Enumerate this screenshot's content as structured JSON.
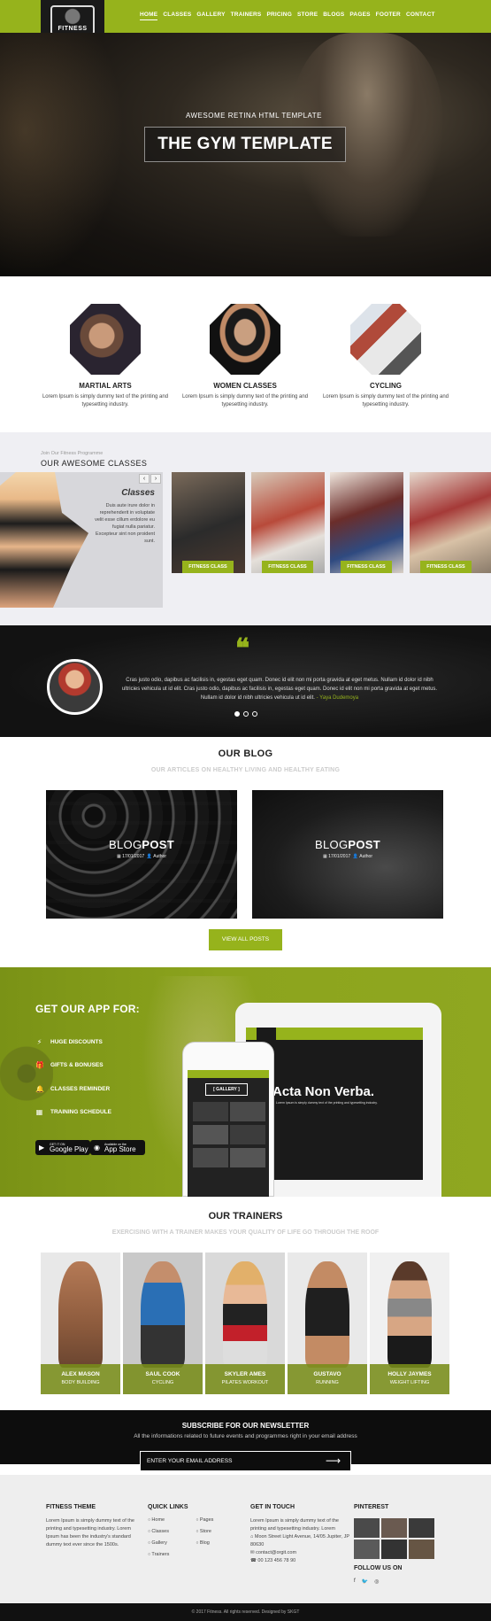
{
  "nav": {
    "logo_text": "FITNESS",
    "items": [
      "HOME",
      "CLASSES",
      "GALLERY",
      "TRAINERS",
      "PRICING",
      "STORE",
      "BLOGS",
      "PAGES",
      "FOOTER",
      "CONTACT"
    ]
  },
  "hero": {
    "subtitle": "AWESOME RETINA HTML TEMPLATE",
    "title": "THE GYM TEMPLATE"
  },
  "features": [
    {
      "title": "MARTIAL ARTS",
      "text": "Lorem Ipsum is simply dummy text of the printing and typesetting industry."
    },
    {
      "title": "WOMEN CLASSES",
      "text": "Lorem Ipsum is simply dummy text of the printing and typesetting industry."
    },
    {
      "title": "CYCLING",
      "text": "Lorem Ipsum is simply dummy text of the printing and typesetting industry."
    }
  ],
  "classes": {
    "pretitle": "Join Our Fitness Programme",
    "title": "OUR AWESOME CLASSES",
    "box_title": "Classes",
    "box_text": "Duis aute irure dolor in reprehenderit in voluptate velit esse cillum erdolore eu fugiat nulla pariatur. Excepteur sint non proident sunt.",
    "prev": "‹",
    "next": "›",
    "cards": [
      "FITNESS CLASS",
      "FITNESS CLASS",
      "FITNESS CLASS",
      "FITNESS CLASS"
    ]
  },
  "testimonial": {
    "quote_mark": "❝",
    "text": "Cras justo odio, dapibus ac facilisis in, egestas eget quam. Donec id elit non mi porta gravida at eget metus. Nullam id dolor id nibh ultricies vehicula ut id elit. Cras justo odio, dapibus ac facilisis in, egestas eget quam. Donec id elit non mi porta gravida at eget metus. Nullam id dolor id nibh ultricies vehicula ut id elit.",
    "author": "- Yaya Dudemoya"
  },
  "blog": {
    "title": "OUR BLOG",
    "subtitle": "OUR ARTICLES ON HEALTHY LIVING AND HEALTHY EATING",
    "posts": [
      {
        "light": "BLOG",
        "bold": "POST",
        "date": "17/01/2017",
        "author": "Author"
      },
      {
        "light": "BLOG",
        "bold": "POST",
        "date": "17/01/2017",
        "author": "Author"
      }
    ],
    "button": "VIEW ALL POSTS"
  },
  "app": {
    "title": "GET OUR APP FOR:",
    "features": [
      {
        "icon": "bolt-icon",
        "glyph": "⚡",
        "label": "HUGE DISCOUNTS"
      },
      {
        "icon": "gift-icon",
        "glyph": "🎁",
        "label": "GIFTS & BONUSES"
      },
      {
        "icon": "bell-icon",
        "glyph": "🔔",
        "label": "CLASSES REMINDER"
      },
      {
        "icon": "calendar-icon",
        "glyph": "▦",
        "label": "TRAINING SCHEDULE"
      }
    ],
    "google_small": "GET IT ON",
    "google_big": "Google Play",
    "apple_small": "Available on the",
    "apple_big": "App Store",
    "tablet_headline": "Acta Non Verba.",
    "tablet_text": "Lorem Ipsum is simply dummy text of the printing and typesetting industry.",
    "phone_gallery": "[ GALLERY ]"
  },
  "trainers": {
    "title": "OUR TRAINERS",
    "subtitle": "EXERCISING WITH A TRAINER MAKES YOUR QUALITY OF LIFE GO THROUGH THE ROOF",
    "list": [
      {
        "name": "ALEX MASON",
        "role": "BODY BUILDING"
      },
      {
        "name": "SAUL COOK",
        "role": "CYCLING"
      },
      {
        "name": "SKYLER AMES",
        "role": "PILATES WORKOUT"
      },
      {
        "name": "GUSTAVO",
        "role": "RUNNING"
      },
      {
        "name": "HOLLY JAYMES",
        "role": "WEIGHT LIFTING"
      }
    ]
  },
  "newsletter": {
    "title": "SUBSCRIBE FOR OUR NEWSLETTER",
    "text": "All the informations related to future events and programmes right in your email address",
    "placeholder": "ENTER YOUR EMAIL ADDRESS",
    "arrow": "⟶"
  },
  "footer": {
    "about_title": "FITNESS THEME",
    "about_text": "Lorem Ipsum is simply dummy text of the printing and typesetting industry. Lorem Ipsum has been the industry's standard dummy text ever since the 1500s.",
    "links_title": "QUICK LINKS",
    "links_col1": [
      "Home",
      "Classes",
      "Gallery",
      "Trainers"
    ],
    "links_col2": [
      "Pages",
      "Store",
      "Blog"
    ],
    "touch_title": "GET IN TOUCH",
    "touch_text": "Lorem Ipsum is simply dummy text of the printing and typesetting industry. Lorem",
    "address": "Moon Street Light Avenue, 14/05 Jupiter, JP 80630",
    "email": "contact@orgit.com",
    "phone": "00 123 456 78 90",
    "pinterest_title": "PINTEREST",
    "follow_title": "FOLLOW US ON",
    "social": [
      "f",
      "🐦",
      "◎"
    ],
    "copyright": "© 2017 Fitness. All rights reserved. Designed by SKGT"
  },
  "colors": {
    "accent": "#96b31c",
    "dark": "#111111",
    "light_bg": "#efeff3"
  }
}
